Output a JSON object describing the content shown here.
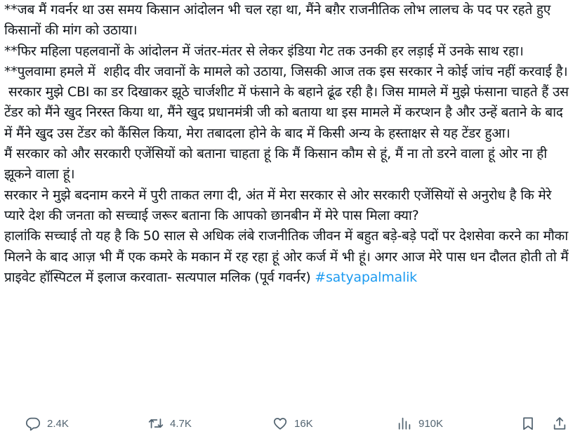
{
  "tweet": {
    "paragraphs": [
      "**जब मैं गवर्नर था उस समय किसान आंदोलन भी चल रहा था, मैंने बग़ैर राजनीतिक लोभ लालच के पद पर रहते हुए किसानों की मांग को उठाया।",
      "**फिर महिला पहलवानों के आंदोलन में जंतर-मंतर से लेकर इंडिया गेट तक उनकी हर लड़ाई में उनके साथ रहा।",
      "**पुलवामा हमले में  शहीद वीर जवानों के मामले को उठाया, जिसकी आज तक इस सरकार ने कोई जांच नहीं करवाई है।",
      " सरकार मुझे CBI का डर दिखाकर झूठे चार्जशीट में फंसाने के बहाने ढूंढ रही है। जिस मामले में मुझे फंसाना चाहते हैं उस टेंडर को मैंने खुद निरस्त किया था, मैंने खुद प्रधानमंत्री जी को बताया था इस मामले में करप्शन है और उन्हें बताने के बाद में मैंने खुद उस टेंडर को कैंसिल किया, मेरा तबादला होने के बाद में किसी अन्य के हस्ताक्षर से यह टेंडर हुआ।",
      "मैं सरकार को और सरकारी एजेंसियों को बताना चाहता हूं कि मैं किसान कौम से हूं, मैं ना तो डरने वाला हूं ओर ना ही झूकने वाला हूं।",
      "सरकार ने मुझे बदनाम करने में पुरी ताकत लगा दी, अंत में मेरा सरकार से ओर सरकारी एजेंसियों से अनुरोध है कि मेरे प्यारे देश की जनता को सच्चाई जरूर बताना कि आपको छानबीन में मेरे पास मिला क्या?",
      "हालांकि सच्चाई तो यह है कि 50 साल से अधिक लंबे राजनीतिक जीवन में बहुत बड़े-बड़े पदों पर देशसेवा करने का मौका मिलने के बाद आज़ भी मैं एक कमरे के मकान में रह रहा हूं ओर कर्ज में भी हूं। अगर आज मेरे पास धन दौलत होती तो मैं प्राइवेट हॉस्पिटल में इलाज करवाता- सत्यपाल मलिक (पूर्व गवर्नर) "
    ],
    "hashtag": "#satyapalmalik"
  },
  "actions": {
    "replies": "2.4K",
    "reposts": "4.7K",
    "likes": "16K",
    "views": "910K",
    "icons": [
      "reply-icon",
      "repost-icon",
      "like-icon",
      "views-icon",
      "bookmark-icon",
      "share-icon"
    ]
  },
  "colors": {
    "text": "#0f1419",
    "hashtag": "#1d9bf0",
    "muted": "#536471"
  }
}
